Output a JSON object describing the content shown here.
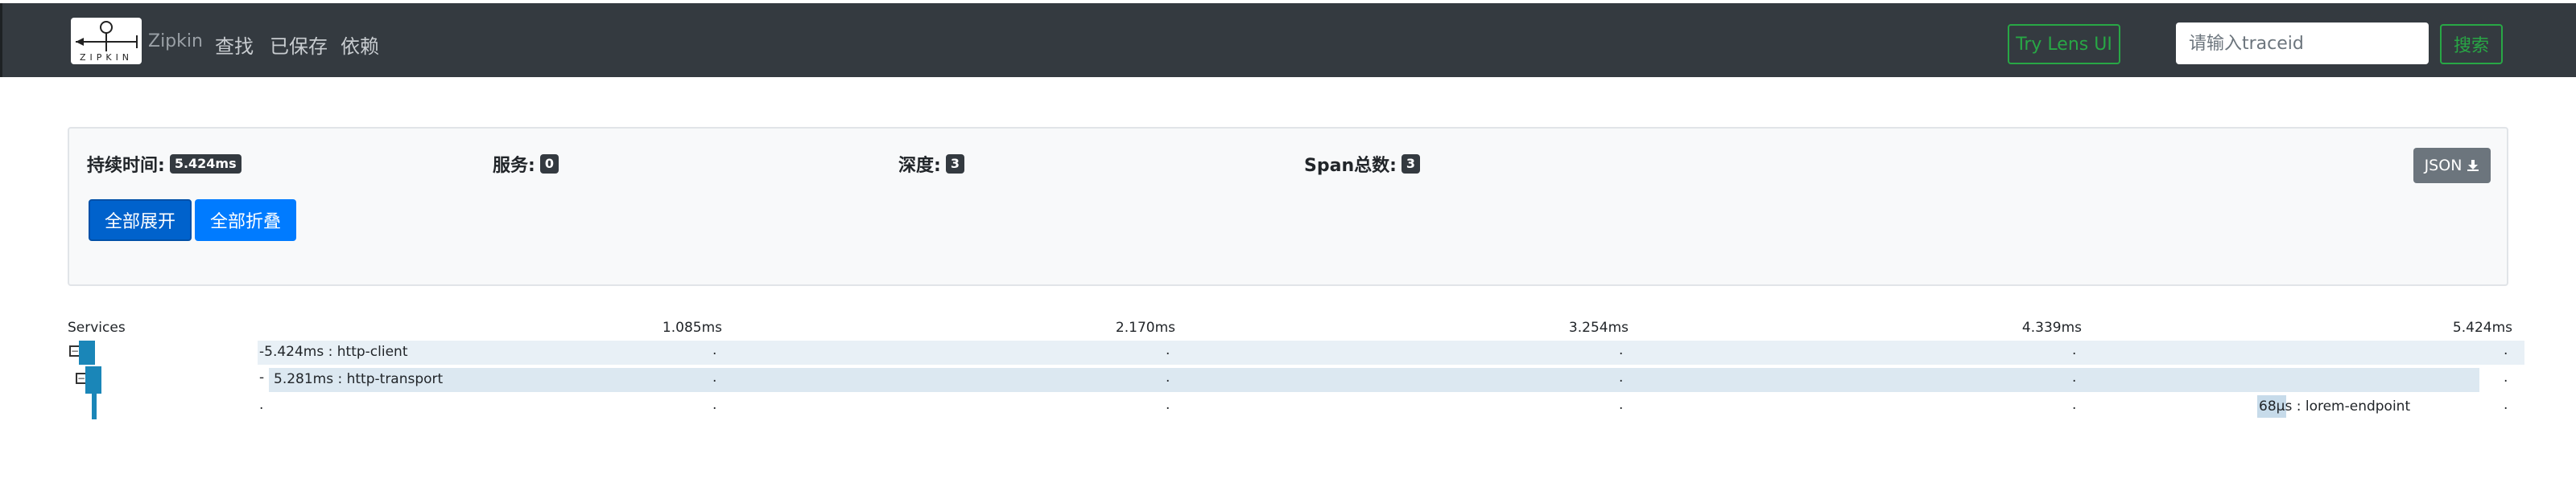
{
  "header": {
    "brand": "Zipkin",
    "logo_text": "ZIPKIN",
    "nav": [
      "查找",
      "已保存",
      "依赖"
    ],
    "lens_button": "Try Lens UI",
    "search_placeholder": "请输入traceid",
    "search_button": "搜索",
    "colors": {
      "background": "#343a40",
      "accent": "#28a745"
    }
  },
  "summary": {
    "duration_label": "持续时间:",
    "duration_value": "5.424ms",
    "services_label": "服务:",
    "services_value": "0",
    "depth_label": "深度:",
    "depth_value": "3",
    "span_count_label": "Span总数:",
    "span_count_value": "3",
    "json_button": "JSON",
    "expand_all": "全部展开",
    "collapse_all": "全部折叠"
  },
  "timeline": {
    "services_header": "Services",
    "ticks": [
      "1.085ms",
      "2.170ms",
      "3.254ms",
      "4.339ms",
      "5.424ms"
    ],
    "spans": [
      {
        "duration": "5.424ms",
        "name": "http-client",
        "text": "5.424ms : http-client"
      },
      {
        "duration": "5.281ms",
        "name": "http-transport",
        "text": "5.281ms : http-transport"
      },
      {
        "duration": "68μs",
        "name": "lorem-endpoint",
        "text": "68μs : lorem-endpoint"
      }
    ],
    "colors": {
      "row_bg": "#dce8f1",
      "service_bar": "#1a86b8"
    }
  }
}
